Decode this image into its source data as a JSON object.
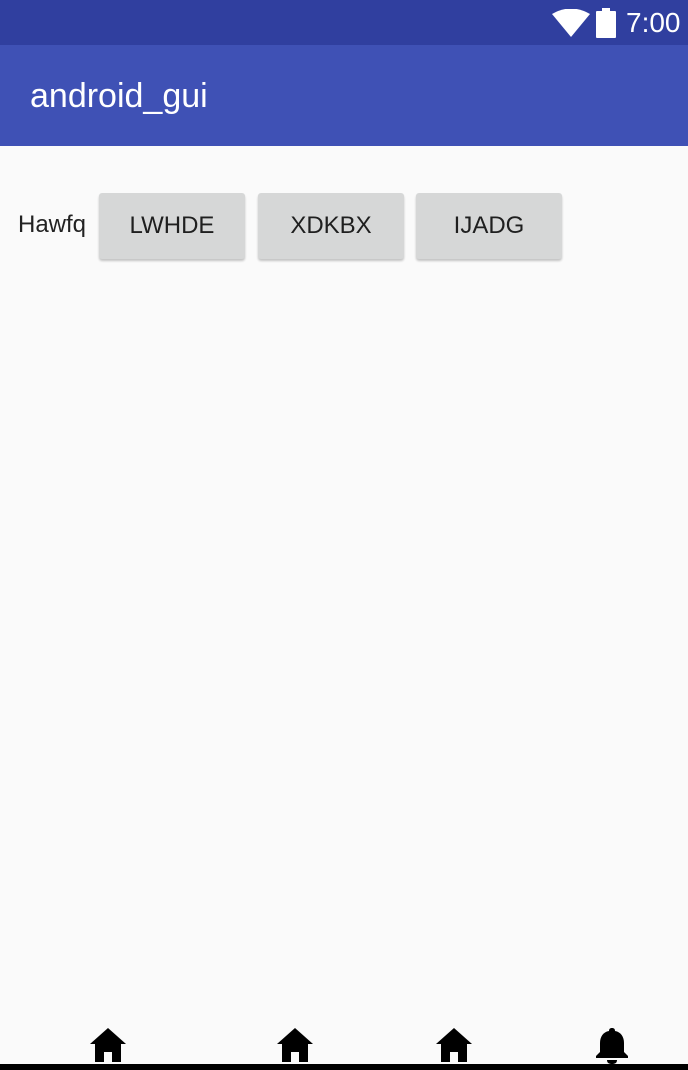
{
  "status_bar": {
    "time": "7:00",
    "icons": [
      "wifi-icon",
      "battery-icon"
    ]
  },
  "app_bar": {
    "title": "android_gui"
  },
  "content": {
    "label": "Hawfq",
    "buttons": [
      "LWHDE",
      "XDKBX",
      "IJADG"
    ]
  },
  "bottom_nav": {
    "items": [
      "home-icon",
      "home-icon",
      "home-icon",
      "bell-icon"
    ]
  },
  "colors": {
    "status_bar": "#303f9f",
    "app_bar": "#3f51b5",
    "background": "#fafafa",
    "button": "#d6d7d7"
  }
}
